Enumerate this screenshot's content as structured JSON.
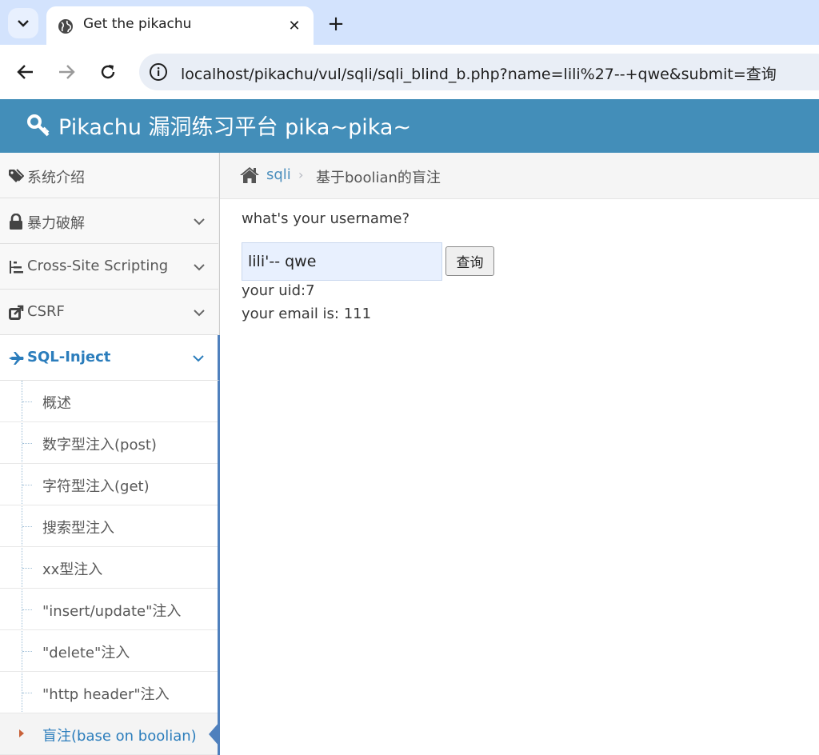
{
  "browser": {
    "tab_title": "Get the pikachu",
    "url": "localhost/pikachu/vul/sqli/sqli_blind_b.php?name=lili%27--+qwe&submit=查询"
  },
  "site": {
    "brand": "Pikachu 漏洞练习平台 pika~pika~"
  },
  "sidebar": {
    "items": [
      {
        "label": "系统介绍",
        "icon": "tags-icon"
      },
      {
        "label": "暴力破解",
        "icon": "lock-icon"
      },
      {
        "label": "Cross-Site Scripting",
        "icon": "list-icon"
      },
      {
        "label": "CSRF",
        "icon": "share-icon"
      },
      {
        "label": "SQL-Inject",
        "icon": "plane-icon"
      }
    ],
    "submenu": [
      {
        "label": "概述"
      },
      {
        "label": "数字型注入(post)"
      },
      {
        "label": "字符型注入(get)"
      },
      {
        "label": "搜索型注入"
      },
      {
        "label": "xx型注入"
      },
      {
        "label": "\"insert/update\"注入"
      },
      {
        "label": "\"delete\"注入"
      },
      {
        "label": "\"http header\"注入"
      },
      {
        "label": "盲注(base on boolian)"
      }
    ]
  },
  "breadcrumb": {
    "link": "sqli",
    "current": "基于boolian的盲注"
  },
  "form": {
    "prompt": "what's your username?",
    "input_value": "lili'-- qwe",
    "submit_label": "查询"
  },
  "result": {
    "uid_line": "your uid:7",
    "email_line": "your email is: 111"
  }
}
